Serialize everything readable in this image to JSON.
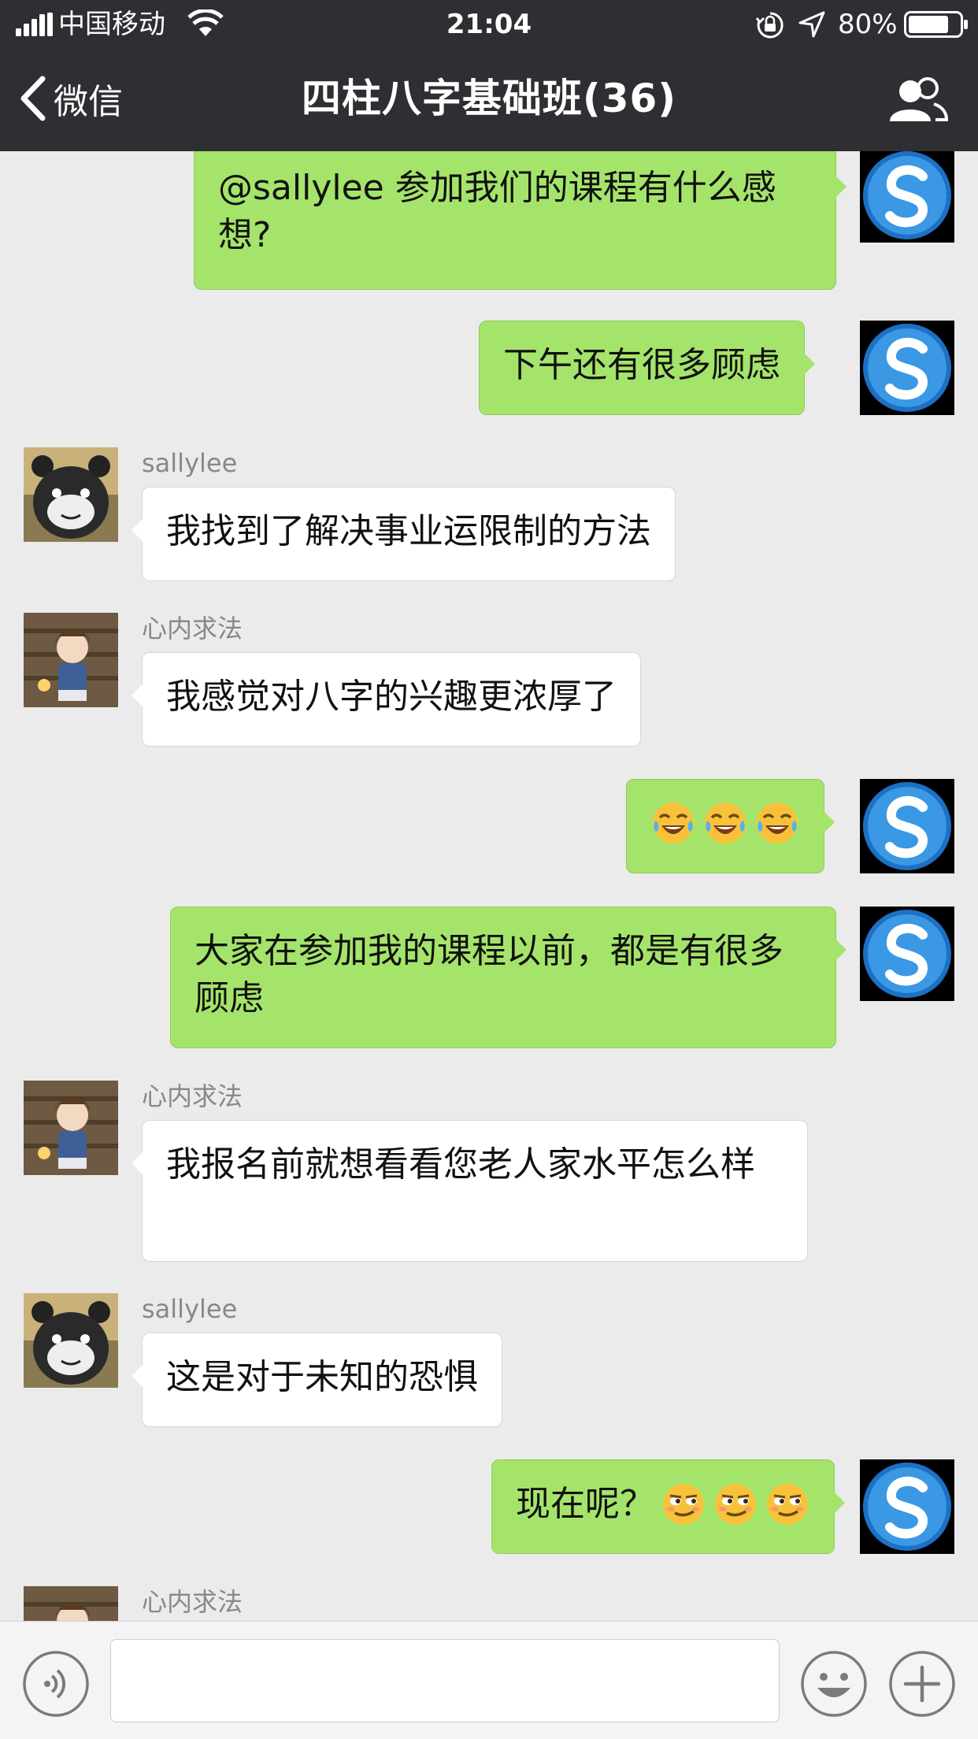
{
  "status_bar": {
    "carrier": "中国移动",
    "time": "21:04",
    "battery_percent": "80%",
    "battery_level": 0.8,
    "icons": [
      "signal-icon",
      "wifi-icon",
      "orientation-lock-icon",
      "location-icon",
      "battery-icon"
    ]
  },
  "nav": {
    "back_label": "微信",
    "title": "四柱八字基础班(36)",
    "right_icon": "group-members-icon"
  },
  "messages": [
    {
      "side": "out",
      "text": "@sallylee 参加我们的课程有什么感想?"
    },
    {
      "side": "out",
      "text": "下午还有很多顾虑"
    },
    {
      "side": "in",
      "sender": "sallylee",
      "text": "我找到了解决事业运限制的方法"
    },
    {
      "side": "in",
      "sender": "心内求法",
      "text": "我感觉对八字的兴趣更浓厚了"
    },
    {
      "side": "out",
      "emojis": [
        "tears-of-joy-emoji",
        "tears-of-joy-emoji",
        "tears-of-joy-emoji"
      ]
    },
    {
      "side": "out",
      "text": "大家在参加我的课程以前，都是有很多顾虑"
    },
    {
      "side": "in",
      "sender": "心内求法",
      "text": "我报名前就想看看您老人家水平怎么样"
    },
    {
      "side": "in",
      "sender": "sallylee",
      "text": "这是对于未知的恐惧"
    },
    {
      "side": "out",
      "text": "现在呢？",
      "emojis": [
        "smirk-emoji",
        "smirk-emoji",
        "smirk-emoji"
      ]
    },
    {
      "side": "in",
      "sender": "心内求法"
    }
  ],
  "input_bar": {
    "voice_icon": "voice-icon",
    "emoji_icon": "emoji-icon",
    "plus_icon": "plus-icon",
    "input_value": ""
  },
  "colors": {
    "header_bg": "#2e2e33",
    "chat_bg": "#ebebeb",
    "outgoing_bubble": "#a5e46b",
    "incoming_bubble": "#ffffff",
    "sender_name": "#888888"
  }
}
